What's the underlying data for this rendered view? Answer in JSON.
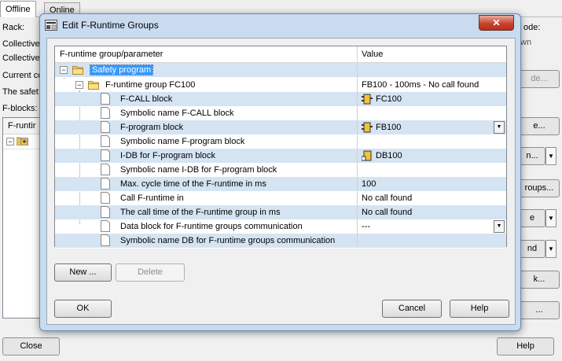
{
  "background": {
    "tabs": [
      "Offline",
      "Online"
    ],
    "labels": [
      "Rack:",
      "Collective",
      "Collective",
      "Current co",
      "The safet",
      "F-blocks:"
    ],
    "right_labels": [
      "ode:",
      "wn"
    ],
    "tree_header": "F-runtir",
    "buttons": [
      "de...",
      "e...",
      "n...",
      "roups...",
      "e",
      "nd",
      "k...",
      "..."
    ],
    "close_label": "Close",
    "help_label": "Help"
  },
  "dialog": {
    "title": "Edit F-Runtime Groups",
    "close_glyph": "✕",
    "grid": {
      "col_param": "F-runtime group/parameter",
      "col_value": "Value",
      "rows": [
        {
          "name": "Safety program",
          "value": ""
        },
        {
          "name": "F-runtime group FC100",
          "value": "FB100 - 100ms - No call found"
        },
        {
          "name": "F-CALL block",
          "value": "FC100"
        },
        {
          "name": "Symbolic name F-CALL block",
          "value": ""
        },
        {
          "name": "F-program block",
          "value": "FB100"
        },
        {
          "name": "Symbolic name F-program block",
          "value": ""
        },
        {
          "name": "I-DB for F-program block",
          "value": "DB100"
        },
        {
          "name": "Symbolic name I-DB for F-program block",
          "value": ""
        },
        {
          "name": "Max. cycle time of the F-runtime in ms",
          "value": "100"
        },
        {
          "name": "Call F-runtime in",
          "value": "No call found"
        },
        {
          "name": "The call time of the F-runtime group in ms",
          "value": "No call found"
        },
        {
          "name": "Data block for F-runtime groups communication",
          "value": "---"
        },
        {
          "name": "Symbolic name DB for F-runtime groups communication",
          "value": ""
        }
      ]
    },
    "buttons": {
      "new": "New ...",
      "delete": "Delete",
      "ok": "OK",
      "cancel": "Cancel",
      "help": "Help"
    }
  },
  "colors": {
    "selection": "#3399ff",
    "row_alt": "#d5e4f2",
    "dialog_frame": "#c9dbef",
    "close_button": "#c8442e"
  }
}
